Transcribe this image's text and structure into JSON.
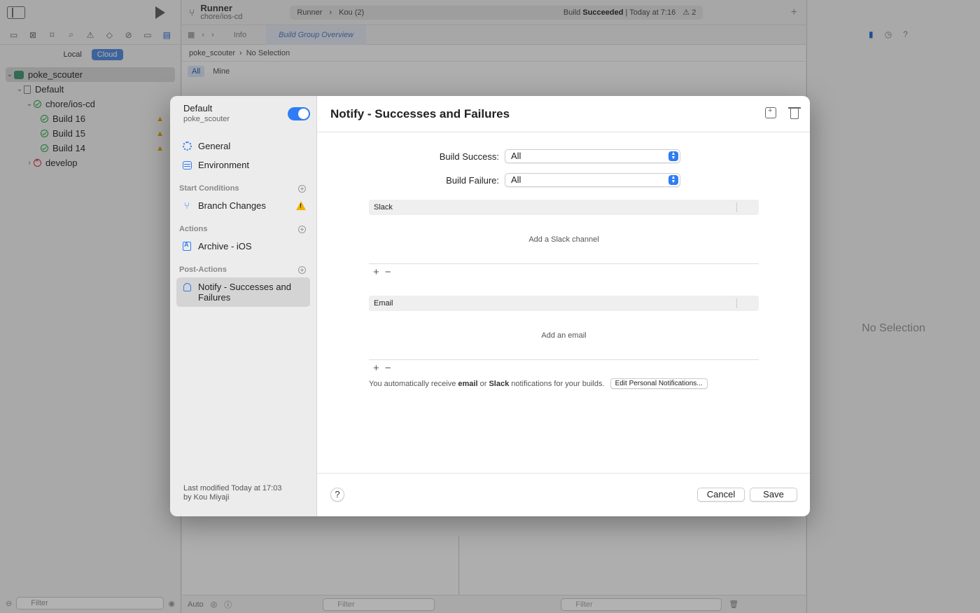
{
  "navigator": {
    "seg_local": "Local",
    "seg_cloud": "Cloud",
    "tree": [
      {
        "label": "poke_scouter"
      },
      {
        "label": "Default"
      },
      {
        "label": "chore/ios-cd"
      },
      {
        "label": "Build 16"
      },
      {
        "label": "Build 15"
      },
      {
        "label": "Build 14"
      },
      {
        "label": "develop"
      }
    ],
    "filter_placeholder": "Filter"
  },
  "toolbar": {
    "scheme_name": "Runner",
    "scheme_branch": "chore/ios-cd",
    "target": "Runner",
    "device": "Kou (2)",
    "status_prefix": "Build",
    "status_result": "Succeeded",
    "status_time": "| Today at 7:16",
    "warning_count": "2"
  },
  "editor": {
    "tab_info": "Info",
    "tab_overview": "Build Group Overview",
    "breadcrumb_project": "poke_scouter",
    "breadcrumb_selection": "No Selection",
    "filter_all": "All",
    "filter_mine": "Mine",
    "debug_auto": "Auto",
    "debug_filter": "Filter",
    "debug_filter2": "Filter"
  },
  "inspector": {
    "no_selection": "No Selection"
  },
  "sheet": {
    "workflow_name": "Default",
    "workflow_product": "poke_scouter",
    "sidebar": {
      "general": "General",
      "environment": "Environment",
      "start_conditions_header": "Start Conditions",
      "branch_changes": "Branch Changes",
      "actions_header": "Actions",
      "archive": "Archive - iOS",
      "post_actions_header": "Post-Actions",
      "notify": "Notify - Successes and Failures"
    },
    "last_modified_line1": "Last modified Today at 17:03",
    "last_modified_line2": "by Kou Miyaji",
    "title": "Notify - Successes and Failures",
    "build_success_label": "Build Success:",
    "build_success_value": "All",
    "build_failure_label": "Build Failure:",
    "build_failure_value": "All",
    "slack_header": "Slack",
    "slack_empty": "Add a Slack channel",
    "email_header": "Email",
    "email_empty": "Add an email",
    "notice_part1": "You automatically receive",
    "notice_email": "email",
    "notice_or": "or",
    "notice_slack": "Slack",
    "notice_part2": "notifications for your builds.",
    "edit_personal_button": "Edit Personal Notifications...",
    "help_label": "?",
    "cancel_label": "Cancel",
    "save_label": "Save"
  },
  "colors": {
    "accent": "#2f7cf6",
    "success": "#2fa64a",
    "failure": "#d9363e",
    "warning": "#f1b400"
  }
}
